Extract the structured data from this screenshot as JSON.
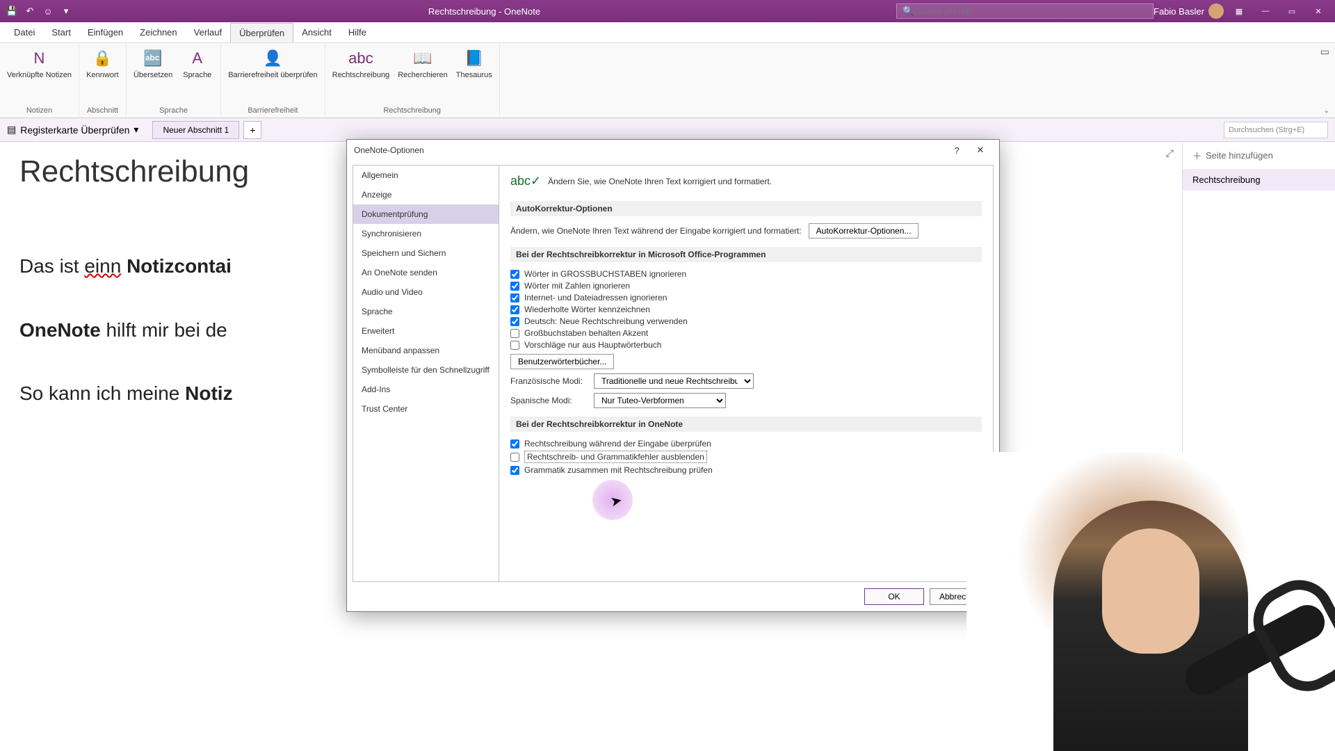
{
  "titlebar": {
    "app_title": "Rechtschreibung - OneNote",
    "search_placeholder": "Suchen (Alt+M)",
    "user": "Fabio Basler"
  },
  "menu": [
    "Datei",
    "Start",
    "Einfügen",
    "Zeichnen",
    "Verlauf",
    "Überprüfen",
    "Ansicht",
    "Hilfe"
  ],
  "menu_active_idx": 5,
  "ribbon": {
    "groups": [
      {
        "label": "Rechtschreibung",
        "buttons": [
          {
            "name": "rechtschreibung",
            "label": "Rechtschreibung",
            "icon": "abc"
          },
          {
            "name": "recherchieren",
            "label": "Recherchieren",
            "icon": "📖"
          },
          {
            "name": "thesaurus",
            "label": "Thesaurus",
            "icon": "📘"
          }
        ]
      },
      {
        "label": "Barrierefreiheit",
        "buttons": [
          {
            "name": "barrierefreiheit",
            "label": "Barrierefreiheit überprüfen",
            "icon": "👤"
          }
        ]
      },
      {
        "label": "Sprache",
        "buttons": [
          {
            "name": "uebersetzen",
            "label": "Übersetzen",
            "icon": "🔤"
          },
          {
            "name": "sprache",
            "label": "Sprache",
            "icon": "A"
          }
        ]
      },
      {
        "label": "Abschnitt",
        "buttons": [
          {
            "name": "kennwort",
            "label": "Kennwort",
            "icon": "🔒"
          }
        ]
      },
      {
        "label": "Notizen",
        "buttons": [
          {
            "name": "verknuepfte",
            "label": "Verknüpfte Notizen",
            "icon": "N"
          }
        ]
      }
    ]
  },
  "notebook": {
    "name": "Registerkarte Überprüfen",
    "tab": "Neuer Abschnitt 1",
    "search": "Durchsuchen (Strg+E)"
  },
  "editor": {
    "title": "Rechtschreibung",
    "line1_pre": "Das ist ",
    "line1_err": "einn",
    "line1_bold": " Notizcontai",
    "line2_bold": "OneNote",
    "line2_rest": " hilft mir bei de",
    "line3_pre": "So kann ich meine ",
    "line3_bold": "Notiz"
  },
  "sidebar": {
    "add": "Seite hinzufügen",
    "page": "Rechtschreibung"
  },
  "dialog": {
    "title": "OneNote-Optionen",
    "nav": [
      "Allgemein",
      "Anzeige",
      "Dokumentprüfung",
      "Synchronisieren",
      "Speichern und Sichern",
      "An OneNote senden",
      "Audio und Video",
      "Sprache",
      "Erweitert",
      "Menüband anpassen",
      "Symbolleiste für den Schnellzugriff",
      "Add-Ins",
      "Trust Center"
    ],
    "nav_sel_idx": 2,
    "header_text": "Ändern Sie, wie OneNote Ihren Text korrigiert und formatiert.",
    "sect_autocorrect": "AutoKorrektur-Optionen",
    "autocorrect_desc": "Ändern, wie OneNote Ihren Text während der Eingabe korrigiert und formatiert:",
    "autocorrect_btn": "AutoKorrektur-Optionen...",
    "sect_office": "Bei der Rechtschreibkorrektur in Microsoft Office-Programmen",
    "office_checks": [
      {
        "label": "Wörter in GROSSBUCHSTABEN ignorieren",
        "checked": true
      },
      {
        "label": "Wörter mit Zahlen ignorieren",
        "checked": true
      },
      {
        "label": "Internet- und Dateiadressen ignorieren",
        "checked": true
      },
      {
        "label": "Wiederholte Wörter kennzeichnen",
        "checked": true
      },
      {
        "label": "Deutsch: Neue Rechtschreibung verwenden",
        "checked": true
      },
      {
        "label": "Großbuchstaben behalten Akzent",
        "checked": false
      },
      {
        "label": "Vorschläge nur aus Hauptwörterbuch",
        "checked": false
      }
    ],
    "dict_btn": "Benutzerwörterbücher...",
    "french_label": "Französische Modi:",
    "french_val": "Traditionelle und neue Rechtschreibung",
    "spanish_label": "Spanische Modi:",
    "spanish_val": "Nur Tuteo-Verbformen",
    "sect_onenote": "Bei der Rechtschreibkorrektur in OneNote",
    "onenote_checks": [
      {
        "label": "Rechtschreibung während der Eingabe überprüfen",
        "checked": true,
        "focus": false
      },
      {
        "label": "Rechtschreib- und Grammatikfehler ausblenden",
        "checked": false,
        "focus": true
      },
      {
        "label": "Grammatik zusammen mit Rechtschreibung prüfen",
        "checked": true,
        "focus": false
      }
    ],
    "ok": "OK",
    "cancel": "Abbrechen"
  }
}
